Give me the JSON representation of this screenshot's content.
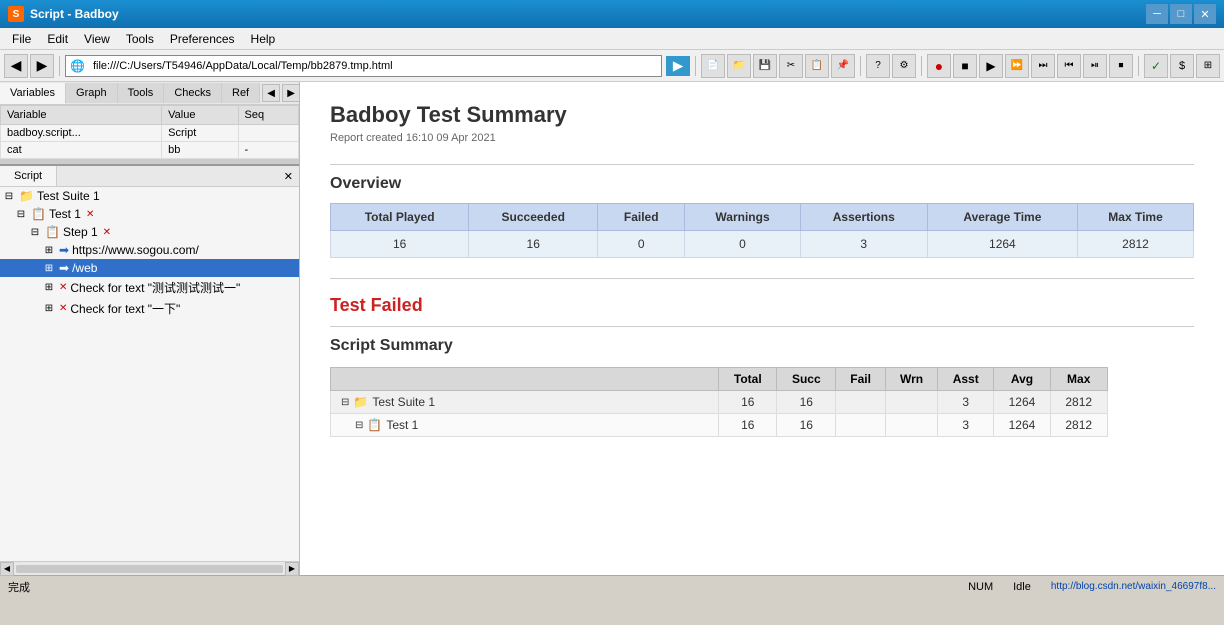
{
  "window": {
    "title": "Script - Badboy"
  },
  "menu": {
    "items": [
      "File",
      "Edit",
      "View",
      "Tools",
      "Preferences",
      "Help"
    ]
  },
  "address": {
    "url": "file:///C:/Users/T54946/AppData/Local/Temp/bb2879.tmp.html",
    "placeholder": ""
  },
  "left_panel": {
    "tabs": [
      "Variables",
      "Graph",
      "Tools",
      "Checks",
      "Ref"
    ],
    "variables": {
      "columns": [
        "Variable",
        "Value",
        "Seq"
      ],
      "rows": [
        {
          "variable": "badboy.script...",
          "value": "Script",
          "seq": ""
        },
        {
          "variable": "cat",
          "value": "bb",
          "seq": "-"
        }
      ]
    }
  },
  "script_panel": {
    "tab": "Script",
    "tree": [
      {
        "level": 0,
        "label": "Test Suite 1",
        "type": "suite",
        "expand": "⊟"
      },
      {
        "level": 1,
        "label": "Test 1",
        "type": "test",
        "expand": "⊟"
      },
      {
        "level": 2,
        "label": "Step 1",
        "type": "step",
        "expand": "⊟"
      },
      {
        "level": 3,
        "label": "https://www.sogou.com/",
        "type": "request",
        "expand": "⊞"
      },
      {
        "level": 3,
        "label": "/web",
        "type": "request-selected",
        "expand": "⊞"
      },
      {
        "level": 3,
        "label": "Check for text \"测试测试测试一\"",
        "type": "check",
        "expand": "⊞"
      },
      {
        "level": 3,
        "label": "Check for text \"一下\"",
        "type": "check",
        "expand": "⊞"
      }
    ]
  },
  "report": {
    "title": "Badboy Test Summary",
    "subtitle": "Report created 16:10 09 Apr 2021",
    "overview_heading": "Overview",
    "overview_table": {
      "columns": [
        "Total Played",
        "Succeeded",
        "Failed",
        "Warnings",
        "Assertions",
        "Average Time",
        "Max Time"
      ],
      "row": [
        "16",
        "16",
        "0",
        "0",
        "3",
        "1264",
        "2812"
      ]
    },
    "test_failed_label": "Test Failed",
    "script_summary_heading": "Script Summary",
    "summary_table": {
      "columns": [
        "",
        "Total",
        "Succ",
        "Fail",
        "Wrn",
        "Asst",
        "Avg",
        "Max"
      ],
      "rows": [
        {
          "name": "Test Suite 1",
          "type": "suite",
          "total": "16",
          "succ": "16",
          "fail": "",
          "wrn": "",
          "asst": "3",
          "avg": "1264",
          "max": "2812"
        },
        {
          "name": "Test 1",
          "type": "test",
          "total": "16",
          "succ": "16",
          "fail": "",
          "wrn": "",
          "asst": "3",
          "avg": "1264",
          "max": "2812"
        }
      ]
    }
  },
  "status_bar": {
    "left": "完成",
    "num": "NUM",
    "idle": "Idle",
    "url_hint": "http://blog.csdn.net/waixin_46697f8..."
  }
}
